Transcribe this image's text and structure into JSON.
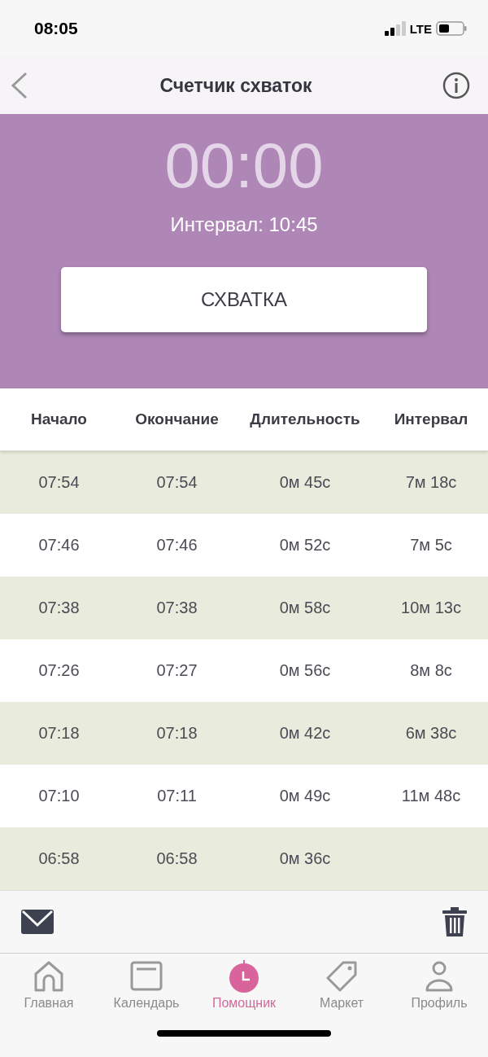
{
  "status_bar": {
    "time": "08:05",
    "network": "LTE"
  },
  "nav": {
    "title": "Счетчик схваток"
  },
  "timer": {
    "display": "00:00",
    "interval": "Интервал: 10:45",
    "button": "СХВАТКА"
  },
  "table": {
    "columns": [
      "Начало",
      "Окончание",
      "Длительность",
      "Интервал"
    ],
    "rows": [
      {
        "start": "07:54",
        "end": "07:54",
        "duration": "0м 45с",
        "interval": "7м 18с"
      },
      {
        "start": "07:46",
        "end": "07:46",
        "duration": "0м 52с",
        "interval": "7м 5с"
      },
      {
        "start": "07:38",
        "end": "07:38",
        "duration": "0м 58с",
        "interval": "10м 13с"
      },
      {
        "start": "07:26",
        "end": "07:27",
        "duration": "0м 56с",
        "interval": "8м 8с"
      },
      {
        "start": "07:18",
        "end": "07:18",
        "duration": "0м 42с",
        "interval": "6м 38с"
      },
      {
        "start": "07:10",
        "end": "07:11",
        "duration": "0м 49с",
        "interval": "11м 48с"
      },
      {
        "start": "06:58",
        "end": "06:58",
        "duration": "0м 36с"
      }
    ]
  },
  "tab_bar": [
    {
      "kind": "home",
      "label": "Главная",
      "selected": false
    },
    {
      "kind": "calendar",
      "label": "Календарь",
      "selected": false
    },
    {
      "kind": "helper",
      "label": "Помощник",
      "selected": true
    },
    {
      "kind": "market",
      "label": "Маркет",
      "selected": false
    },
    {
      "kind": "profile",
      "label": "Профиль",
      "selected": false
    }
  ]
}
